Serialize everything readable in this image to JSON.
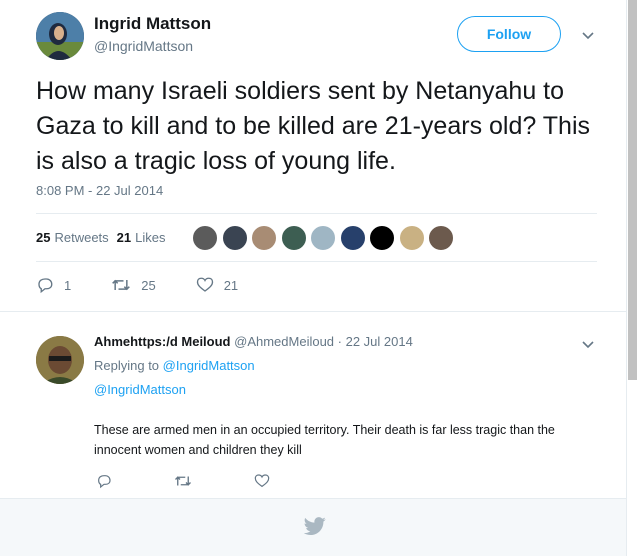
{
  "author": {
    "name": "Ingrid Mattson",
    "handle": "@IngridMattson",
    "follow_label": "Follow"
  },
  "tweet": {
    "text": "How many Israeli soldiers sent by Netanyahu to Gaza to kill and to be killed are 21-years old? This is also a tragic loss of young life.",
    "timestamp": "8:08 PM - 22 Jul 2014"
  },
  "stats": {
    "retweets_count": "25",
    "retweets_label": "Retweets",
    "likes_count": "21",
    "likes_label": "Likes",
    "likers": [
      {
        "name": "liker-1",
        "color": "#5b5b5b"
      },
      {
        "name": "liker-2",
        "color": "#3a4452"
      },
      {
        "name": "liker-3",
        "color": "#a88c74"
      },
      {
        "name": "liker-4",
        "color": "#3d5e52"
      },
      {
        "name": "liker-5",
        "color": "#9fb6c4"
      },
      {
        "name": "liker-6",
        "color": "#27406b"
      },
      {
        "name": "liker-7",
        "color": "#000000"
      },
      {
        "name": "liker-8",
        "color": "#c9b183"
      },
      {
        "name": "liker-9",
        "color": "#6c5a4d"
      }
    ]
  },
  "actions": {
    "reply_count": "1",
    "retweet_count": "25",
    "like_count": "21"
  },
  "reply": {
    "name": "Ahmehttps:/d Meiloud",
    "handle_date": "@AhmedMeiloud · 22 Jul 2014",
    "replying_prefix": "Replying to",
    "replying_to": "@IngridMattson",
    "mention": "@IngridMattson",
    "text": "These are armed men in an occupied territory. Their death is far less tragic than the innocent women and children they kill"
  },
  "colors": {
    "accent": "#1da1f2",
    "muted": "#657786",
    "text": "#14171a"
  }
}
